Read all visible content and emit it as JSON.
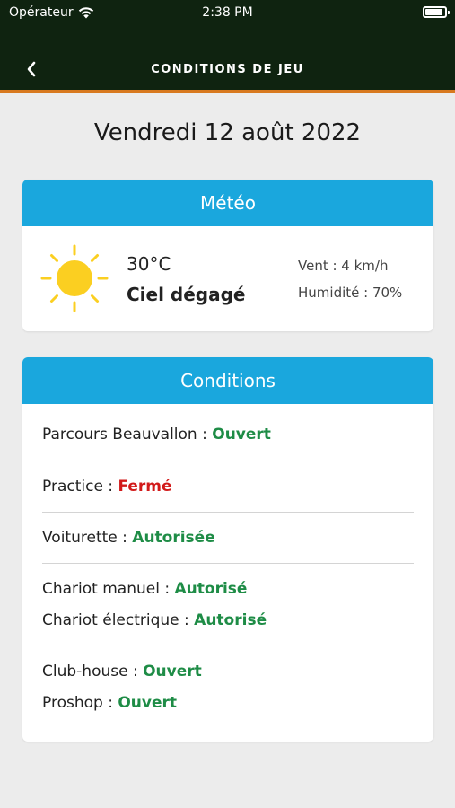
{
  "status_bar": {
    "carrier": "Opérateur",
    "time": "2:38 PM",
    "battery_level": 1.0
  },
  "nav": {
    "title": "CONDITIONS DE JEU",
    "back_icon": "chevron-left-icon"
  },
  "date": "Vendredi 12 août 2022",
  "meteo": {
    "header": "Météo",
    "icon": "sun-icon",
    "temperature": "30°C",
    "sky": "Ciel dégagé",
    "wind": "Vent : 4 km/h",
    "humidity": "Humidité : 70%"
  },
  "conditions": {
    "header": "Conditions",
    "items": [
      {
        "label": "Parcours Beauvallon : ",
        "status": "Ouvert",
        "state": "ok"
      },
      {
        "label": "Practice  : ",
        "status": "Fermé",
        "state": "ko"
      },
      {
        "label": "Voiturette  : ",
        "status": "Autorisée",
        "state": "ok"
      },
      {
        "label": "Chariot manuel  : ",
        "status": "Autorisé",
        "state": "ok"
      },
      {
        "label": "Chariot électrique  : ",
        "status": "Autorisé",
        "state": "ok"
      },
      {
        "label": "Club-house  : ",
        "status": "Ouvert",
        "state": "ok"
      },
      {
        "label": "Proshop  : ",
        "status": "Ouvert",
        "state": "ok"
      }
    ]
  },
  "colors": {
    "header_bg": "#0f2310",
    "accent_orange": "#d8791f",
    "card_header": "#1aa7dd",
    "open_green": "#1e8c46",
    "closed_red": "#d21a1a"
  }
}
